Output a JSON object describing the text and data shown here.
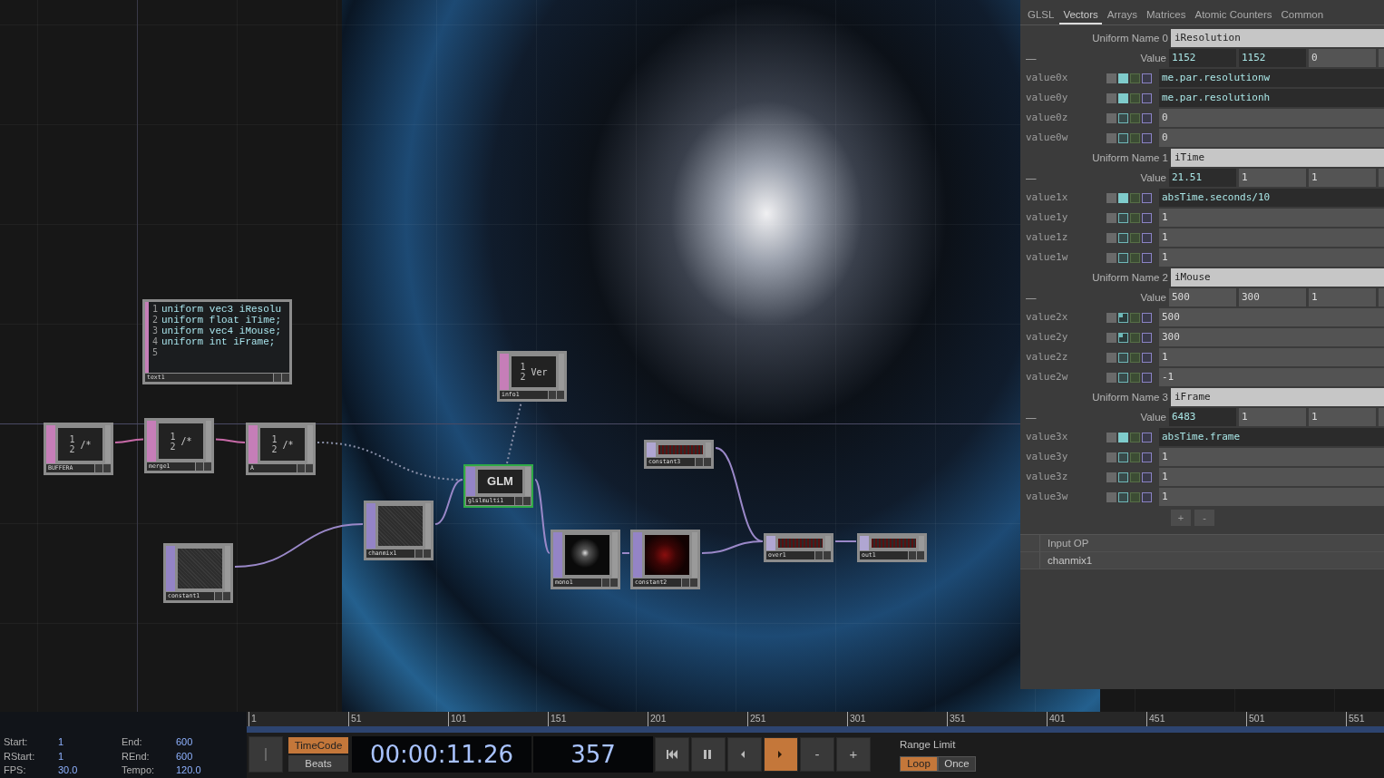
{
  "network": {
    "nodes": [
      {
        "name": "text1",
        "kind": "dat",
        "selected": false,
        "preview": {
          "kind": "code",
          "lines": [
            {
              "num": "1",
              "code": "uniform vec3 iResolu"
            },
            {
              "num": "2",
              "code": "uniform float iTime;"
            },
            {
              "num": "3",
              "code": "uniform vec4 iMouse;"
            },
            {
              "num": "4",
              "code": "uniform int iFrame;"
            },
            {
              "num": "5"
            }
          ]
        }
      },
      {
        "name": "BUFFERA",
        "kind": "dat",
        "selected": false,
        "preview": {
          "kind": "text",
          "numbers": [
            "1",
            "2"
          ],
          "text": "/*"
        }
      },
      {
        "name": "merge1",
        "kind": "dat",
        "selected": false,
        "preview": {
          "kind": "text",
          "numbers": [
            "1",
            "2"
          ],
          "text": "/*"
        }
      },
      {
        "name": "A",
        "kind": "dat",
        "selected": false,
        "preview": {
          "kind": "text",
          "numbers": [
            "1",
            "2"
          ],
          "text": "/*"
        }
      },
      {
        "name": "info1",
        "kind": "dat",
        "selected": false,
        "preview": {
          "kind": "text",
          "numbers": [
            "1",
            "2"
          ],
          "text": "Ver"
        }
      },
      {
        "name": "glslmulti1",
        "kind": "top",
        "selected": true,
        "preview": {
          "kind": "label",
          "text": "GLM"
        }
      },
      {
        "name": "constant3",
        "kind": "chop",
        "selected": false,
        "preview": {
          "kind": "channel"
        }
      },
      {
        "name": "chanmix1",
        "kind": "top",
        "selected": false,
        "preview": {
          "kind": "noise"
        }
      },
      {
        "name": "constant1",
        "kind": "top",
        "selected": false,
        "preview": {
          "kind": "noise"
        }
      },
      {
        "name": "mono1",
        "kind": "top",
        "selected": false,
        "preview": {
          "kind": "mono"
        }
      },
      {
        "name": "constant2",
        "kind": "top",
        "selected": false,
        "preview": {
          "kind": "red"
        }
      },
      {
        "name": "over1",
        "kind": "chop",
        "selected": false,
        "preview": {
          "kind": "channel"
        }
      },
      {
        "name": "out1",
        "kind": "chop",
        "selected": false,
        "preview": {
          "kind": "channel"
        }
      }
    ]
  },
  "parameters": {
    "tabs": [
      {
        "label": "GLSL",
        "selected": false
      },
      {
        "label": "Vectors",
        "selected": true
      },
      {
        "label": "Arrays",
        "selected": false
      },
      {
        "label": "Matrices",
        "selected": false
      },
      {
        "label": "Atomic Counters",
        "selected": false
      },
      {
        "label": "Common",
        "selected": false
      }
    ],
    "uniforms": [
      {
        "label": "Uniform Name 0",
        "name": "iResolution",
        "collapse": "—",
        "value_label": "Value",
        "values": [
          "1152",
          "1152",
          "0"
        ],
        "components": [
          {
            "label": "value0x",
            "kind": "expression",
            "value": "me.par.resolutionw"
          },
          {
            "label": "value0y",
            "kind": "expression",
            "value": "me.par.resolutionh"
          },
          {
            "label": "value0z",
            "kind": "constant",
            "value": "0"
          },
          {
            "label": "value0w",
            "kind": "constant",
            "value": "0"
          }
        ]
      },
      {
        "label": "Uniform Name 1",
        "name": "iTime",
        "collapse": "—",
        "value_label": "Value",
        "values": [
          "21.51",
          "1",
          "1"
        ],
        "components": [
          {
            "label": "value1x",
            "kind": "expression",
            "value": "absTime.seconds/10"
          },
          {
            "label": "value1y",
            "kind": "constant",
            "value": "1"
          },
          {
            "label": "value1z",
            "kind": "constant",
            "value": "1"
          },
          {
            "label": "value1w",
            "kind": "constant",
            "value": "1"
          }
        ]
      },
      {
        "label": "Uniform Name 2",
        "name": "iMouse",
        "collapse": "—",
        "value_label": "Value",
        "values": [
          "500",
          "300",
          "1"
        ],
        "components": [
          {
            "label": "value2x",
            "kind": "modified",
            "value": "500"
          },
          {
            "label": "value2y",
            "kind": "modified",
            "value": "300"
          },
          {
            "label": "value2z",
            "kind": "constant",
            "value": "1"
          },
          {
            "label": "value2w",
            "kind": "constant",
            "value": "-1"
          }
        ]
      },
      {
        "label": "Uniform Name 3",
        "name": "iFrame",
        "collapse": "—",
        "value_label": "Value",
        "values": [
          "6483",
          "1",
          "1"
        ],
        "components": [
          {
            "label": "value3x",
            "kind": "expression",
            "value": "absTime.frame"
          },
          {
            "label": "value3y",
            "kind": "constant",
            "value": "1"
          },
          {
            "label": "value3z",
            "kind": "constant",
            "value": "1"
          },
          {
            "label": "value3w",
            "kind": "constant",
            "value": "1"
          }
        ]
      }
    ],
    "add_button": "+",
    "remove_button": "-",
    "input_op": {
      "label": "Input OP",
      "value": "chanmix1"
    }
  },
  "timeline": {
    "info": [
      {
        "label": "Start:",
        "value": "1"
      },
      {
        "label": "End:",
        "value": "600"
      },
      {
        "label": "RStart:",
        "value": "1"
      },
      {
        "label": "REnd:",
        "value": "600"
      },
      {
        "label": "FPS:",
        "value": "30.0"
      },
      {
        "label": "Tempo:",
        "value": "120.0"
      }
    ],
    "ruler": [
      "1",
      "51",
      "101",
      "151",
      "201",
      "251",
      "301",
      "351",
      "401",
      "451",
      "501",
      "551"
    ],
    "time_modes": [
      {
        "label": "TimeCode",
        "selected": true
      },
      {
        "label": "Beats",
        "selected": false
      }
    ],
    "timecode": "00:00:11.26",
    "frame": "357",
    "transport": [
      {
        "kind": "first",
        "selected": false
      },
      {
        "kind": "pause",
        "selected": false
      },
      {
        "kind": "back",
        "selected": false
      },
      {
        "kind": "play",
        "selected": true
      },
      {
        "kind": "minus",
        "label": "-",
        "selected": false
      },
      {
        "kind": "plus",
        "label": "+",
        "selected": false
      }
    ],
    "range_label": "Range Limit",
    "range_modes": [
      {
        "label": "Loop",
        "selected": true
      },
      {
        "label": "Once",
        "selected": false
      }
    ]
  }
}
